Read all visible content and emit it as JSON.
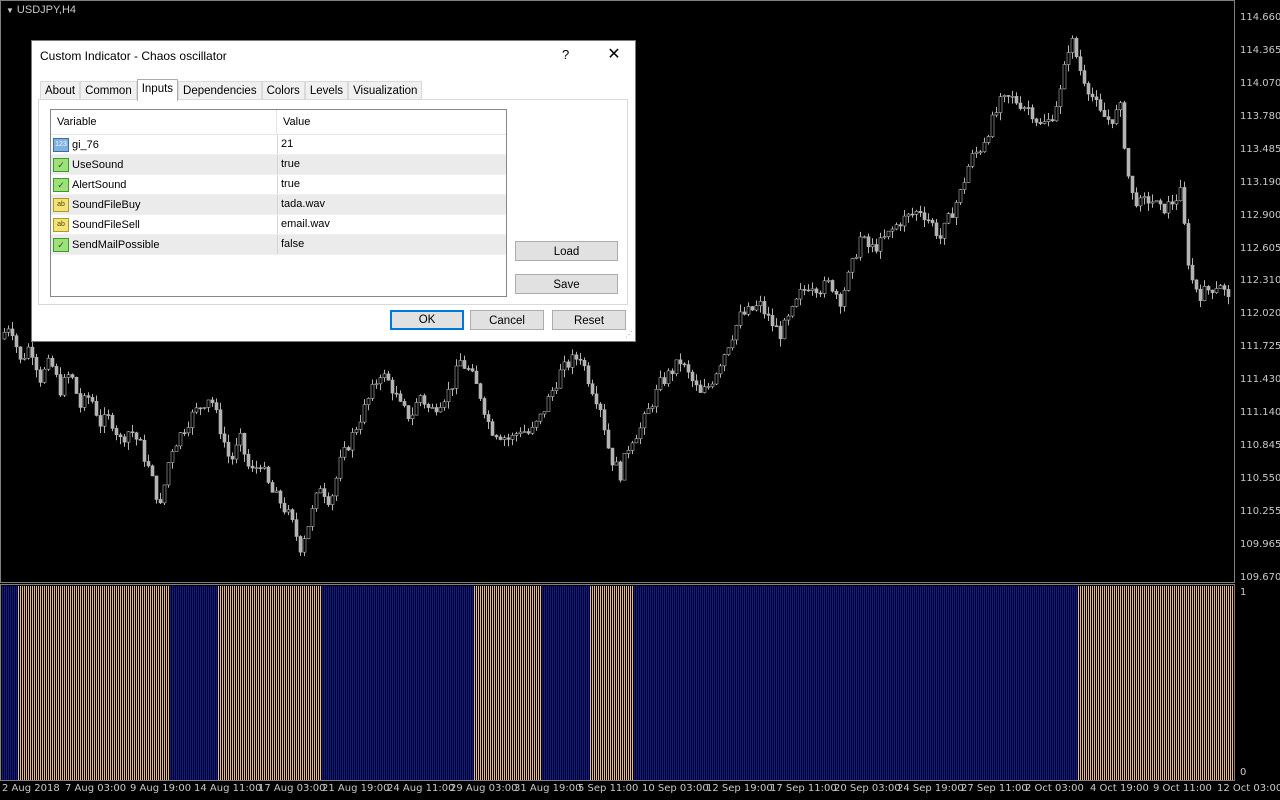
{
  "chart": {
    "symbol": "USDJPY,H4",
    "price_axis": [
      "114.660",
      "114.365",
      "114.070",
      "113.780",
      "113.485",
      "113.190",
      "112.900",
      "112.605",
      "112.310",
      "112.020",
      "111.725",
      "111.430",
      "111.140",
      "110.845",
      "110.550",
      "110.255",
      "109.965",
      "109.670"
    ],
    "indicator_axis": [
      "1",
      "0"
    ],
    "date_axis": [
      "2 Aug 2018",
      "7 Aug 03:00",
      "9 Aug 19:00",
      "14 Aug 11:00",
      "17 Aug 03:00",
      "21 Aug 19:00",
      "24 Aug 11:00",
      "29 Aug 03:00",
      "31 Aug 19:00",
      "5 Sep 11:00",
      "10 Sep 03:00",
      "12 Sep 19:00",
      "17 Sep 11:00",
      "20 Sep 03:00",
      "24 Sep 19:00",
      "27 Sep 11:00",
      "2 Oct 03:00",
      "4 Oct 19:00",
      "9 Oct 11:00",
      "12 Oct 03:00"
    ],
    "colors": {
      "background": "#000000",
      "candle": "#b4b4b4",
      "bull_bar": "#e8b890",
      "bear_bar": "#0f18a0",
      "axis": "#808080"
    }
  },
  "chart_data": {
    "type": "candlestick",
    "title": "USDJPY,H4",
    "ylim": [
      109.67,
      114.66
    ],
    "close_path": [
      [
        0,
        111.8
      ],
      [
        10,
        111.95
      ],
      [
        20,
        111.6
      ],
      [
        30,
        111.75
      ],
      [
        40,
        111.45
      ],
      [
        50,
        111.6
      ],
      [
        60,
        111.35
      ],
      [
        70,
        111.5
      ],
      [
        80,
        111.2
      ],
      [
        90,
        111.3
      ],
      [
        100,
        111.05
      ],
      [
        110,
        111.1
      ],
      [
        120,
        110.9
      ],
      [
        130,
        111.0
      ],
      [
        140,
        110.85
      ],
      [
        150,
        110.6
      ],
      [
        160,
        110.3
      ],
      [
        170,
        110.8
      ],
      [
        180,
        110.95
      ],
      [
        190,
        111.1
      ],
      [
        200,
        111.2
      ],
      [
        210,
        111.3
      ],
      [
        220,
        111.0
      ],
      [
        230,
        110.7
      ],
      [
        240,
        110.9
      ],
      [
        250,
        110.6
      ],
      [
        260,
        110.7
      ],
      [
        270,
        110.45
      ],
      [
        280,
        110.35
      ],
      [
        290,
        110.2
      ],
      [
        300,
        109.95
      ],
      [
        310,
        110.2
      ],
      [
        320,
        110.5
      ],
      [
        330,
        110.35
      ],
      [
        340,
        110.7
      ],
      [
        350,
        110.9
      ],
      [
        360,
        111.1
      ],
      [
        370,
        111.3
      ],
      [
        380,
        111.5
      ],
      [
        390,
        111.4
      ],
      [
        400,
        111.2
      ],
      [
        410,
        111.1
      ],
      [
        420,
        111.3
      ],
      [
        430,
        111.15
      ],
      [
        440,
        111.25
      ],
      [
        450,
        111.35
      ],
      [
        460,
        111.6
      ],
      [
        470,
        111.5
      ],
      [
        480,
        111.3
      ],
      [
        490,
        111.0
      ],
      [
        500,
        110.95
      ],
      [
        510,
        110.9
      ],
      [
        520,
        111.0
      ],
      [
        530,
        110.95
      ],
      [
        540,
        111.1
      ],
      [
        550,
        111.3
      ],
      [
        560,
        111.5
      ],
      [
        570,
        111.6
      ],
      [
        580,
        111.65
      ],
      [
        590,
        111.4
      ],
      [
        600,
        111.2
      ],
      [
        610,
        110.75
      ],
      [
        620,
        110.6
      ],
      [
        630,
        110.9
      ],
      [
        640,
        111.0
      ],
      [
        650,
        111.2
      ],
      [
        660,
        111.4
      ],
      [
        670,
        111.5
      ],
      [
        680,
        111.6
      ],
      [
        690,
        111.45
      ],
      [
        700,
        111.3
      ],
      [
        710,
        111.4
      ],
      [
        720,
        111.6
      ],
      [
        730,
        111.8
      ],
      [
        740,
        112.0
      ],
      [
        750,
        112.05
      ],
      [
        760,
        112.1
      ],
      [
        770,
        111.95
      ],
      [
        780,
        111.85
      ],
      [
        790,
        112.0
      ],
      [
        800,
        112.2
      ],
      [
        810,
        112.3
      ],
      [
        820,
        112.25
      ],
      [
        830,
        112.3
      ],
      [
        840,
        112.15
      ],
      [
        850,
        112.4
      ],
      [
        860,
        112.7
      ],
      [
        870,
        112.6
      ],
      [
        880,
        112.65
      ],
      [
        890,
        112.75
      ],
      [
        900,
        112.85
      ],
      [
        910,
        112.9
      ],
      [
        920,
        112.95
      ],
      [
        930,
        112.85
      ],
      [
        940,
        112.7
      ],
      [
        950,
        112.9
      ],
      [
        960,
        113.1
      ],
      [
        970,
        113.4
      ],
      [
        980,
        113.5
      ],
      [
        990,
        113.7
      ],
      [
        1000,
        113.9
      ],
      [
        1010,
        113.95
      ],
      [
        1020,
        113.9
      ],
      [
        1030,
        113.85
      ],
      [
        1040,
        113.7
      ],
      [
        1050,
        113.75
      ],
      [
        1060,
        114.0
      ],
      [
        1070,
        114.5
      ],
      [
        1080,
        114.2
      ],
      [
        1090,
        114.0
      ],
      [
        1100,
        113.8
      ],
      [
        1110,
        113.75
      ],
      [
        1120,
        113.85
      ],
      [
        1130,
        113.1
      ],
      [
        1140,
        113.0
      ],
      [
        1150,
        113.05
      ],
      [
        1160,
        112.95
      ],
      [
        1170,
        113.0
      ],
      [
        1180,
        113.1
      ],
      [
        1190,
        112.35
      ],
      [
        1200,
        112.2
      ],
      [
        1210,
        112.25
      ],
      [
        1220,
        112.3
      ],
      [
        1230,
        112.1
      ]
    ]
  },
  "dialog": {
    "title": "Custom Indicator - Chaos oscillator",
    "help": "?",
    "close": "✕",
    "tabs": [
      "About",
      "Common",
      "Inputs",
      "Dependencies",
      "Colors",
      "Levels",
      "Visualization"
    ],
    "active_tab": "Inputs",
    "columns": [
      "Variable",
      "Value"
    ],
    "rows": [
      {
        "icon": "123",
        "icon_type": "number-icon",
        "variable": "gi_76",
        "value": "21"
      },
      {
        "icon": "✓",
        "icon_type": "bool-icon",
        "variable": "UseSound",
        "value": "true"
      },
      {
        "icon": "✓",
        "icon_type": "bool-icon",
        "variable": "AlertSound",
        "value": "true"
      },
      {
        "icon": "ab",
        "icon_type": "string-icon",
        "variable": "SoundFileBuy",
        "value": "tada.wav"
      },
      {
        "icon": "ab",
        "icon_type": "string-icon",
        "variable": "SoundFileSell",
        "value": "email.wav"
      },
      {
        "icon": "✓",
        "icon_type": "bool-icon",
        "variable": "SendMailPossible",
        "value": "false"
      }
    ],
    "buttons": {
      "load": "Load",
      "save": "Save",
      "ok": "OK",
      "cancel": "Cancel",
      "reset": "Reset"
    }
  }
}
